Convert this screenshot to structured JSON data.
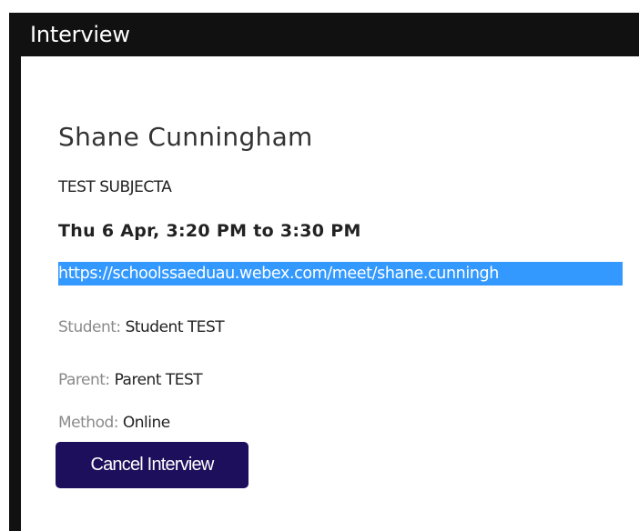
{
  "window": {
    "title": "Interview"
  },
  "interview": {
    "teacher_name": "Shane Cunningham",
    "subject": "TEST SUBJECTA",
    "datetime": "Thu 6 Apr, 3:20 PM to 3:30 PM",
    "meeting_link": "https://schoolssaeduau.webex.com/meet/shane.cunningh",
    "student_label": "Student:",
    "student_value": "Student TEST",
    "parent_label": "Parent:",
    "parent_value": "Parent TEST",
    "method_label": "Method:",
    "method_value": "Online"
  },
  "actions": {
    "cancel_label": "Cancel Interview"
  },
  "colors": {
    "title_bar": "#111111",
    "link_highlight": "#3399ff",
    "button": "#1e0f5c"
  }
}
